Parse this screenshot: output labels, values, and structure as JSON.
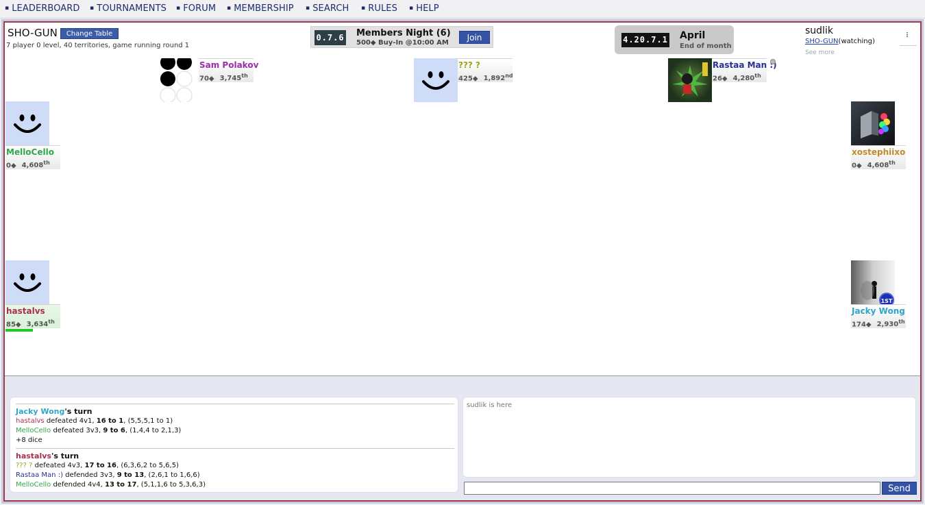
{
  "nav": {
    "items": [
      {
        "label": "LEADERBOARD",
        "bullet": "▪"
      },
      {
        "label": "TOURNAMENTS",
        "bullet": "▪"
      },
      {
        "label": "FORUM",
        "bullet": "▪"
      },
      {
        "label": "MEMBERSHIP",
        "bullet": "▪"
      },
      {
        "label": "SEARCH",
        "bullet": "▪"
      },
      {
        "label": "RULES",
        "bullet": "▪"
      },
      {
        "label": "HELP",
        "bullet": "▪"
      }
    ]
  },
  "game": {
    "title": "SHO-GUN",
    "change_table_label": "Change Table",
    "info": "7 player 0 level, 40 territories, game running round 1"
  },
  "tournament": {
    "code": "0.7.6",
    "name": "Members Night (6)",
    "subtitle": "500◆ Buy-In @10:00 AM",
    "join_label": "Join"
  },
  "monthly": {
    "code": "4.20.7.1",
    "name": "April",
    "subtitle": "End of month"
  },
  "user": {
    "name": "sudlik",
    "room_link": "SHO-GUN",
    "room_status": "(watching)",
    "see_more": "See more",
    "menu_glyph": "⠇"
  },
  "players": [
    {
      "name": "Sam Polakov",
      "chips": "70◆",
      "rank": "3,745",
      "rank_suffix": "th",
      "color": "#9b2fa8",
      "avatar": "circles-icon"
    },
    {
      "name": "??? ?",
      "chips": "425◆",
      "rank": "1,892",
      "rank_suffix": "nd",
      "color": "#9aa21a",
      "avatar": "smiley-icon"
    },
    {
      "name": "Rastaa Man :)",
      "chips": "26◆",
      "rank": "4,280",
      "rank_suffix": "th",
      "color": "#2a2f93",
      "avatar": "rasta-avatar-icon"
    },
    {
      "name": "MelloCello",
      "chips": "0◆",
      "rank": "4,608",
      "rank_suffix": "th",
      "color": "#2ea84a",
      "avatar": "smiley-icon"
    },
    {
      "name": "xostephiixo",
      "chips": "0◆",
      "rank": "4,608",
      "rank_suffix": "th",
      "color": "#c08a2a",
      "avatar": "lamp-avatar-icon"
    },
    {
      "name": "hastalvs",
      "chips": "85◆",
      "rank": "3,634",
      "rank_suffix": "th",
      "color": "#a8304a",
      "avatar": "smiley-icon",
      "hp": 0.5
    },
    {
      "name": "Jacky Wong",
      "chips": "174◆",
      "rank": "2,930",
      "rank_suffix": "th",
      "color": "#2fa6c8",
      "avatar": "figure-avatar-icon",
      "badge": "1ST"
    }
  ],
  "log": {
    "turns": [
      {
        "player": "Jacky Wong",
        "player_color": "#2fa6c8",
        "suffix": "'s turn",
        "lines": [
          {
            "who": "hastalvs",
            "who_color": "#a8304a",
            "action": " defeated 4v1, ",
            "score": "16 to 1",
            "rest": ", (5,5,5,1 to 1)"
          },
          {
            "who": "MelloCello",
            "who_color": "#2ea84a",
            "action": " defeated 3v3, ",
            "score": "9 to 6",
            "rest": ", (1,4,4 to 2,1,3)"
          },
          {
            "who": "",
            "who_color": "#111",
            "action": "+8 dice",
            "score": "",
            "rest": ""
          }
        ]
      },
      {
        "player": "hastalvs",
        "player_color": "#a8304a",
        "suffix": "'s turn",
        "lines": [
          {
            "who": "??? ?",
            "who_color": "#9aa21a",
            "action": " defeated 4v3, ",
            "score": "17 to 16",
            "rest": ", (6,3,6,2 to 5,6,5)"
          },
          {
            "who": "Rastaa Man :)",
            "who_color": "#2a2f93",
            "action": " defended 3v3, ",
            "score": "9 to 13",
            "rest": ", (2,6,1 to 1,6,6)"
          },
          {
            "who": "MelloCello",
            "who_color": "#2ea84a",
            "action": " defended 4v4, ",
            "score": "13 to 17",
            "rest": ", (5,1,1,6 to 5,3,6,3)"
          }
        ]
      }
    ]
  },
  "chat": {
    "messages": [
      "sudlik is here"
    ],
    "input_value": "",
    "send_label": "Send"
  }
}
